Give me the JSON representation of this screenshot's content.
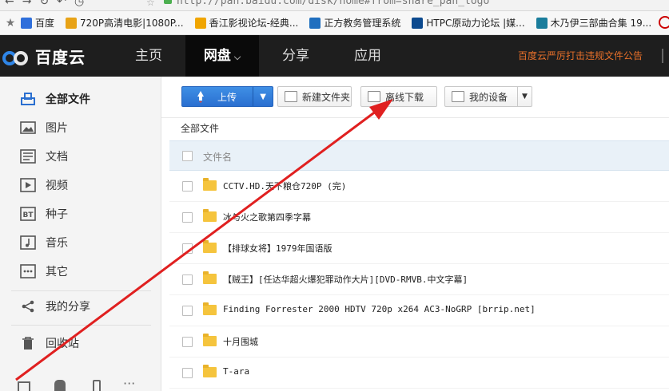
{
  "browser": {
    "url": "http://pan.baidu.com/disk/home#from=share_pan_logo",
    "bookmarks": [
      {
        "label": "百度",
        "color": "#2f6fdb"
      },
      {
        "label": "720P高清电影|1080P...",
        "color": "#e8a317"
      },
      {
        "label": "香江影视论坛-经典...",
        "color": "#f0a500"
      },
      {
        "label": "正方教务管理系统",
        "color": "#1f6fbf"
      },
      {
        "label": "HTPC原动力论坛 |媒...",
        "color": "#0c4a8f"
      },
      {
        "label": "木乃伊三部曲合集 19...",
        "color": "#1a7d9c"
      }
    ]
  },
  "nav": {
    "logo_text": "百度云",
    "tabs": [
      "主页",
      "网盘",
      "分享",
      "应用"
    ],
    "active_tab_index": 1,
    "notice": "百度云严厉打击违规文件公告"
  },
  "sidebar": {
    "items": [
      {
        "label": "全部文件",
        "icon": "file-list-icon",
        "active": true
      },
      {
        "label": "图片",
        "icon": "image-icon"
      },
      {
        "label": "文档",
        "icon": "document-icon"
      },
      {
        "label": "视频",
        "icon": "video-icon"
      },
      {
        "label": "种子",
        "icon": "bt-torrent-icon"
      },
      {
        "label": "音乐",
        "icon": "music-icon"
      },
      {
        "label": "其它",
        "icon": "more-icon"
      },
      {
        "label": "我的分享",
        "icon": "share-icon"
      },
      {
        "label": "回收站",
        "icon": "trash-icon"
      }
    ],
    "bottom_icons": [
      "checkbox-icon",
      "android-icon",
      "phone-icon",
      "ellipsis-icon"
    ]
  },
  "toolbar": {
    "upload_label": "上传",
    "new_folder_label": "新建文件夹",
    "offline_download_label": "离线下载",
    "my_devices_label": "我的设备"
  },
  "breadcrumb": "全部文件",
  "list": {
    "header_label": "文件名",
    "files": [
      "CCTV.HD.天下粮仓720P (完)",
      "冰与火之歌第四季字幕",
      "【排球女将】1979年国语版",
      "【贼王】[任达华超火爆犯罪动作大片][DVD-RMVB.中文字幕]",
      "Finding Forrester 2000 HDTV 720p x264 AC3-NoGRP [brrip.net]",
      "十月围城",
      "T-ara"
    ]
  },
  "colors": {
    "nav_bg": "#1e1e1e",
    "notice": "#e8702a",
    "upload_btn": "#3a86e0",
    "annotation_arrow": "#e02020",
    "folder": "#f5c43d"
  }
}
